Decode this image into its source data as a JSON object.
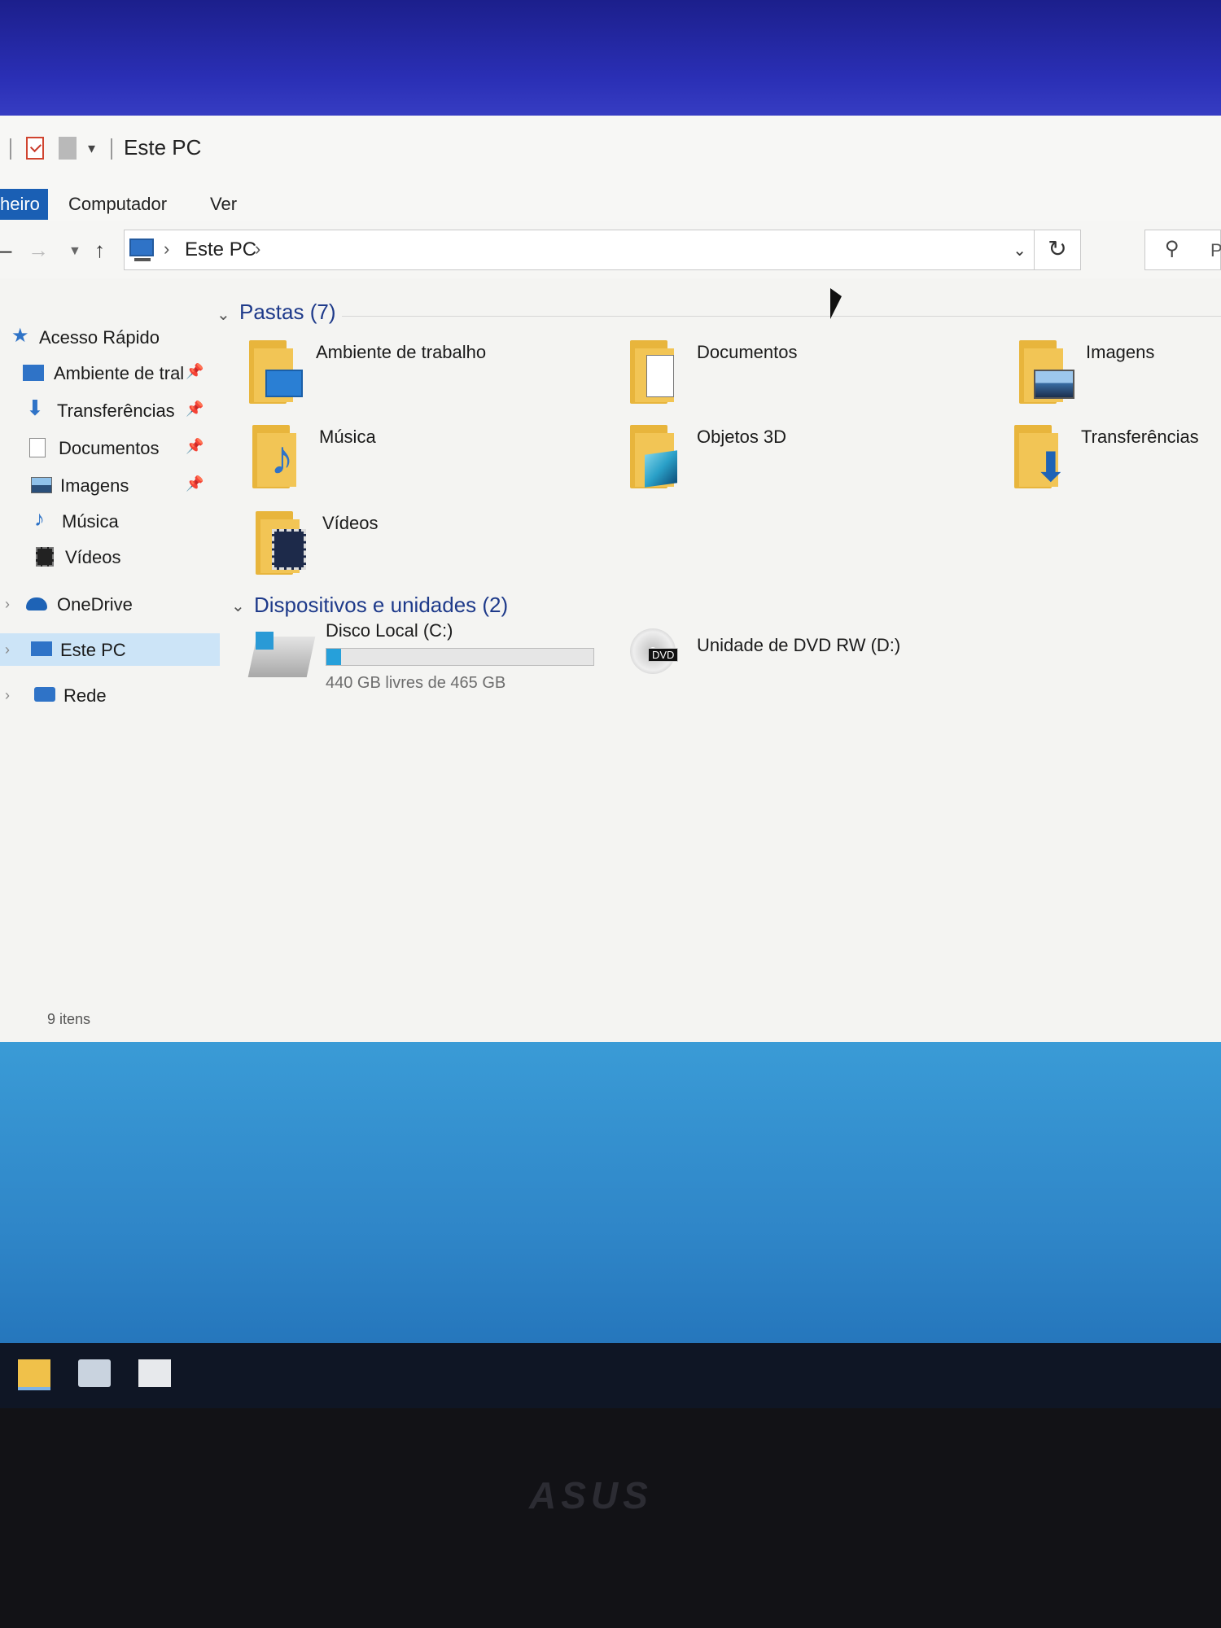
{
  "window": {
    "title": "Este PC"
  },
  "ribbon": {
    "tabs": {
      "file": "heiro",
      "computer": "Computador",
      "view": "Ver"
    }
  },
  "address": {
    "path": "Este PC",
    "search_placeholder": "P"
  },
  "nav": {
    "quick_access": "Acesso Rápido",
    "items": [
      {
        "label": "Ambiente de tral",
        "pinned": true,
        "icon": "desktop-icon"
      },
      {
        "label": "Transferências",
        "pinned": true,
        "icon": "download-icon"
      },
      {
        "label": "Documentos",
        "pinned": true,
        "icon": "document-icon"
      },
      {
        "label": "Imagens",
        "pinned": true,
        "icon": "image-icon"
      },
      {
        "label": "Música",
        "pinned": false,
        "icon": "music-icon"
      },
      {
        "label": "Vídeos",
        "pinned": false,
        "icon": "video-icon"
      }
    ],
    "onedrive": "OneDrive",
    "este_pc": "Este PC",
    "rede": "Rede"
  },
  "content": {
    "folders_header": "Pastas (7)",
    "folders": [
      {
        "label": "Ambiente de trabalho",
        "icon": "desktop-folder-icon"
      },
      {
        "label": "Documentos",
        "icon": "documents-folder-icon"
      },
      {
        "label": "Imagens",
        "icon": "pictures-folder-icon"
      },
      {
        "label": "Música",
        "icon": "music-folder-icon"
      },
      {
        "label": "Objetos 3D",
        "icon": "3d-objects-folder-icon"
      },
      {
        "label": "Transferências",
        "icon": "downloads-folder-icon"
      },
      {
        "label": "Vídeos",
        "icon": "videos-folder-icon"
      }
    ],
    "devices_header": "Dispositivos e unidades (2)",
    "drives": [
      {
        "label": "Disco Local (C:)",
        "free_text": "440 GB livres de 465 GB",
        "used_fraction": 0.054,
        "icon": "hard-drive-icon"
      },
      {
        "label": "Unidade de DVD RW (D:)",
        "badge": "DVD",
        "icon": "dvd-drive-icon"
      }
    ]
  },
  "status": {
    "count": "9 itens"
  },
  "monitor": {
    "brand": "ASUS"
  },
  "colors": {
    "accent": "#1a5fb4",
    "folder": "#f2c555",
    "selection": "#cce4f7",
    "drive_fill": "#26a0da"
  }
}
